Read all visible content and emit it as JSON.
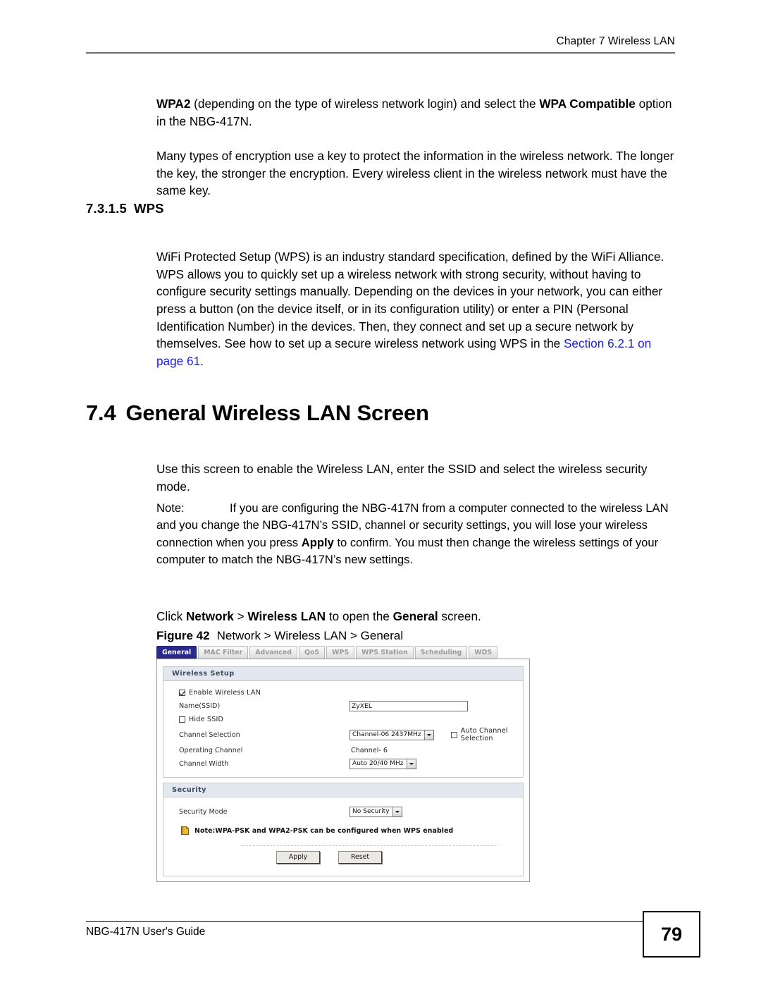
{
  "header": {
    "chapter": "Chapter 7 Wireless LAN"
  },
  "footer": {
    "guide": "NBG-417N User's Guide",
    "page_number": "79"
  },
  "body": {
    "para_wpa2_a": "WPA2",
    "para_wpa2_b": " (depending on the type of wireless network login) and select the ",
    "para_wpa2_c": "WPA Compatible",
    "para_wpa2_d": " option in the NBG-417N.",
    "para_encryption": "Many types of encryption use a key to protect the information in the wireless network. The longer the key, the stronger the encryption. Every wireless client in the wireless network must have the same key.",
    "heading_wps_num": "7.3.1.5",
    "heading_wps_title": "WPS",
    "para_wps_a": "WiFi Protected Setup (WPS) is an industry standard specification, defined by the WiFi Alliance. WPS allows you to quickly set up a wireless network with strong security, without having to configure security settings manually. Depending on the devices in your network, you can either press a button (on the device itself, or in its configuration utility) or enter a PIN (Personal Identification Number) in the devices. Then, they connect and set up a secure network by themselves. See how to set up a secure wireless network using WPS in the ",
    "para_wps_link": "Section 6.2.1 on page 61",
    "para_wps_end": ".",
    "heading_general_num": "7.4",
    "heading_general_title": "General Wireless LAN Screen",
    "para_use_screen": "Use this screen to enable the Wireless LAN, enter the SSID and select the wireless security mode.",
    "note_label": "Note:",
    "note_a": "If you are configuring the NBG-417N from a computer connected to the wireless LAN and you change the NBG-417N’s SSID, channel or security settings, you will lose your wireless connection when you press ",
    "note_bold": "Apply",
    "note_b": " to confirm. You must then change the wireless settings of your computer to match the NBG-417N’s new settings.",
    "click_a": "Click ",
    "click_network": "Network",
    "click_gt1": " > ",
    "click_wireless_lan": "Wireless LAN",
    "click_mid": " to open the ",
    "click_general": "General",
    "click_end": " screen."
  },
  "figure": {
    "number": "Figure 42",
    "caption": "Network > Wireless LAN > General"
  },
  "router_ui": {
    "tabs": [
      {
        "label": "General",
        "active": true
      },
      {
        "label": "MAC Filter",
        "active": false
      },
      {
        "label": "Advanced",
        "active": false
      },
      {
        "label": "QoS",
        "active": false
      },
      {
        "label": "WPS",
        "active": false
      },
      {
        "label": "WPS Station",
        "active": false
      },
      {
        "label": "Scheduling",
        "active": false
      },
      {
        "label": "WDS",
        "active": false
      }
    ],
    "wireless_setup": {
      "section_title": "Wireless Setup",
      "enable_wireless_lan_label": "Enable Wireless LAN",
      "enable_wireless_lan_checked": "checked",
      "name_ssid_label": "Name(SSID)",
      "name_ssid_value": "ZyXEL",
      "hide_ssid_label": "Hide SSID",
      "hide_ssid_checked": "unchecked",
      "channel_selection_label": "Channel Selection",
      "channel_selection_value": "Channel-06 2437MHz",
      "auto_channel_selection_label": "Auto Channel Selection",
      "auto_channel_selection_checked": "unchecked",
      "operating_channel_label": "Operating Channel",
      "operating_channel_value": "Channel- 6",
      "channel_width_label": "Channel Width",
      "channel_width_value": "Auto 20/40 MHz"
    },
    "security": {
      "section_title": "Security",
      "security_mode_label": "Security Mode",
      "security_mode_value": "No Security",
      "note_text": "Note:WPA-PSK and WPA2-PSK can be configured when WPS enabled"
    },
    "buttons": {
      "apply": "Apply",
      "reset": "Reset"
    },
    "colors": {
      "active_tab_bg": "#2a2a8c",
      "section_header_bg": "#e3e7ee",
      "note_icon": "#e8b93c",
      "link": "#1a1ae0"
    }
  }
}
